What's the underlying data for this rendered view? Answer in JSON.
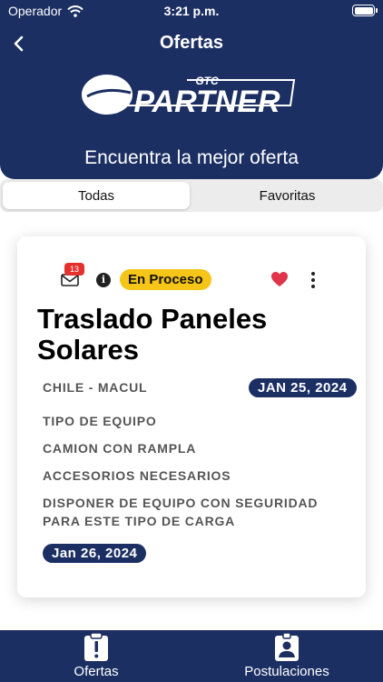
{
  "status_bar": {
    "carrier": "Operador",
    "time": "3:21 p.m."
  },
  "nav": {
    "title": "Ofertas",
    "back_icon": "chevron-left-icon"
  },
  "header": {
    "tagline": "Encuentra la mejor oferta"
  },
  "logo": {
    "line1": "GTC",
    "line2": "PARTNER"
  },
  "segmented": {
    "options": [
      "Todas",
      "Favoritas"
    ],
    "selected": "Todas"
  },
  "offer": {
    "message_count": "13",
    "status": "En Proceso",
    "title": "Traslado Paneles Solares",
    "location": "CHILE - MACUL",
    "date_start": "JAN 25, 2024",
    "equipment_label": "TIPO DE EQUIPO",
    "equipment_value": "CAMION CON RAMPLA",
    "accessories_label": "ACCESORIOS NECESARIOS",
    "accessories_line1": "DISPONER DE EQUIPO CON SEGURIDAD",
    "accessories_line2": "PARA ESTE TIPO DE CARGA",
    "date_end": "Jan 26, 2024"
  },
  "tab_bar": {
    "items": [
      {
        "label": "Ofertas",
        "icon": "clipboard-alert-icon"
      },
      {
        "label": "Postulaciones",
        "icon": "badge-person-icon"
      }
    ]
  },
  "colors": {
    "primary": "#1c2f63",
    "status_badge": "#f5c518",
    "heart": "#e0344a",
    "message_badge": "#e53030"
  }
}
